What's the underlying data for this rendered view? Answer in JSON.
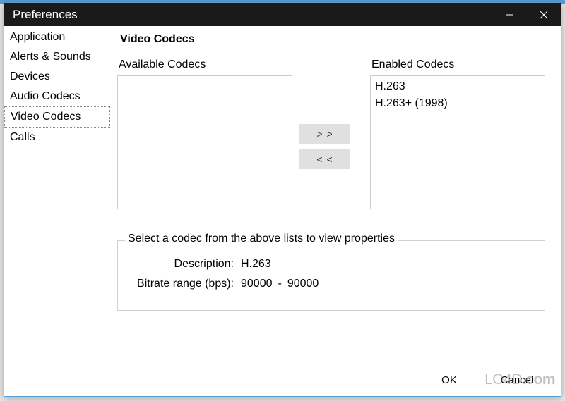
{
  "window": {
    "title": "Preferences"
  },
  "sidebar": {
    "items": [
      {
        "label": "Application",
        "selected": false
      },
      {
        "label": "Alerts & Sounds",
        "selected": false
      },
      {
        "label": "Devices",
        "selected": false
      },
      {
        "label": "Audio Codecs",
        "selected": false
      },
      {
        "label": "Video Codecs",
        "selected": true
      },
      {
        "label": "Calls",
        "selected": false
      }
    ]
  },
  "content": {
    "title": "Video Codecs",
    "available_label": "Available Codecs",
    "enabled_label": "Enabled Codecs",
    "available": [],
    "enabled": [
      {
        "label": "H.263"
      },
      {
        "label": "H.263+ (1998)"
      }
    ],
    "transfer": {
      "add": "> >",
      "remove": "< <"
    },
    "details": {
      "legend": "Select a codec from the above lists to view properties",
      "description_label": "Description:",
      "description_value": "H.263",
      "bitrate_label": "Bitrate range (bps):",
      "bitrate_min": "90000",
      "bitrate_sep": "-",
      "bitrate_max": "90000"
    }
  },
  "footer": {
    "ok": "OK",
    "cancel": "Cancel"
  },
  "watermark": "LO4D.com"
}
